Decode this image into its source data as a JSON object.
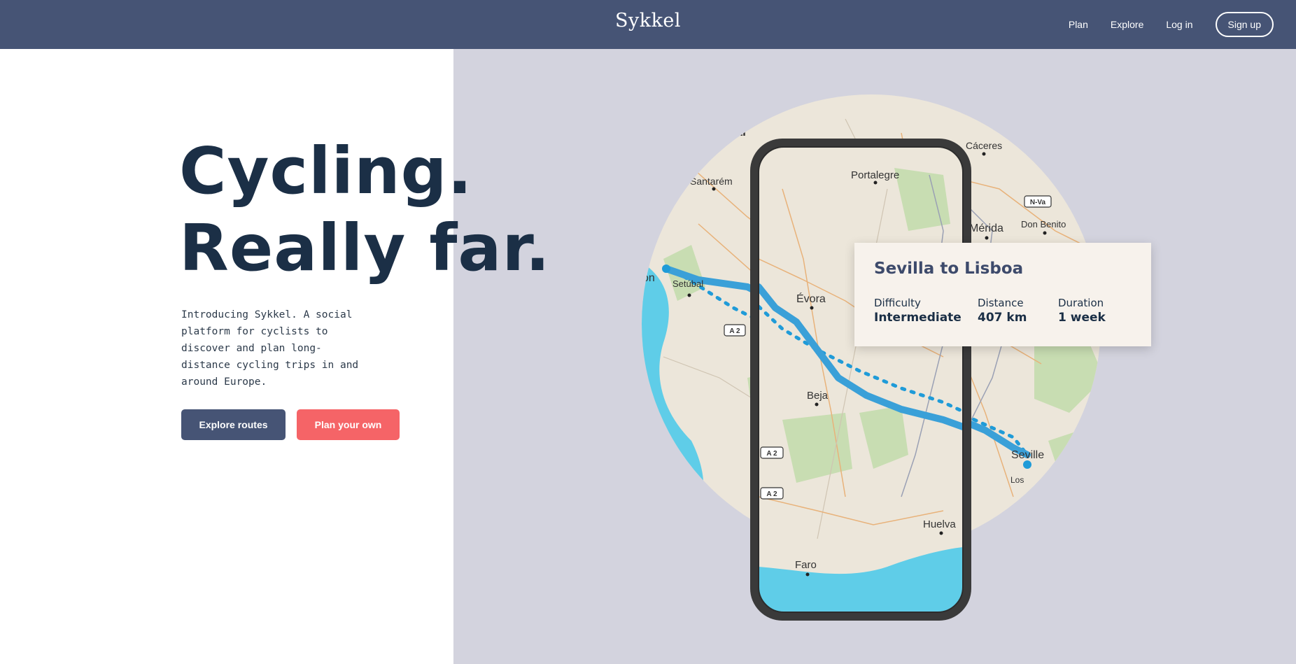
{
  "header": {
    "brand": "Sykkel",
    "nav": [
      {
        "label": "Plan"
      },
      {
        "label": "Explore"
      },
      {
        "label": "Log in"
      }
    ],
    "signup_label": "Sign up"
  },
  "hero": {
    "headline_line1": "Cycling.",
    "headline_line2": "Really far.",
    "intro": "Introducing Sykkel. A social platform for cyclists to discover and plan long-distance cycling trips in and around Europe.",
    "explore_button": "Explore routes",
    "plan_button": "Plan your own"
  },
  "map": {
    "labels": [
      "Portalegre",
      "Cáceres",
      "Mérida",
      "Don Benito",
      "Santarém",
      "Évora",
      "Setúbal",
      "Beja",
      "Seville",
      "Huelva",
      "Faro",
      "Los",
      "gal",
      "on"
    ],
    "road_badges": [
      "N-Va",
      "A 2",
      "A 2",
      "A 2"
    ]
  },
  "route": {
    "title": "Sevilla to Lisboa",
    "difficulty_label": "Difficulty",
    "difficulty_value": "Intermediate",
    "distance_label": "Distance",
    "distance_value": "407 km",
    "duration_label": "Duration",
    "duration_value": "1 week"
  },
  "colors": {
    "header": "#465475",
    "panel": "#d3d3de",
    "headline": "#1b2f46",
    "accent_red": "#f56467",
    "route_blue": "#3aa0d8",
    "sea": "#5fcde8"
  }
}
